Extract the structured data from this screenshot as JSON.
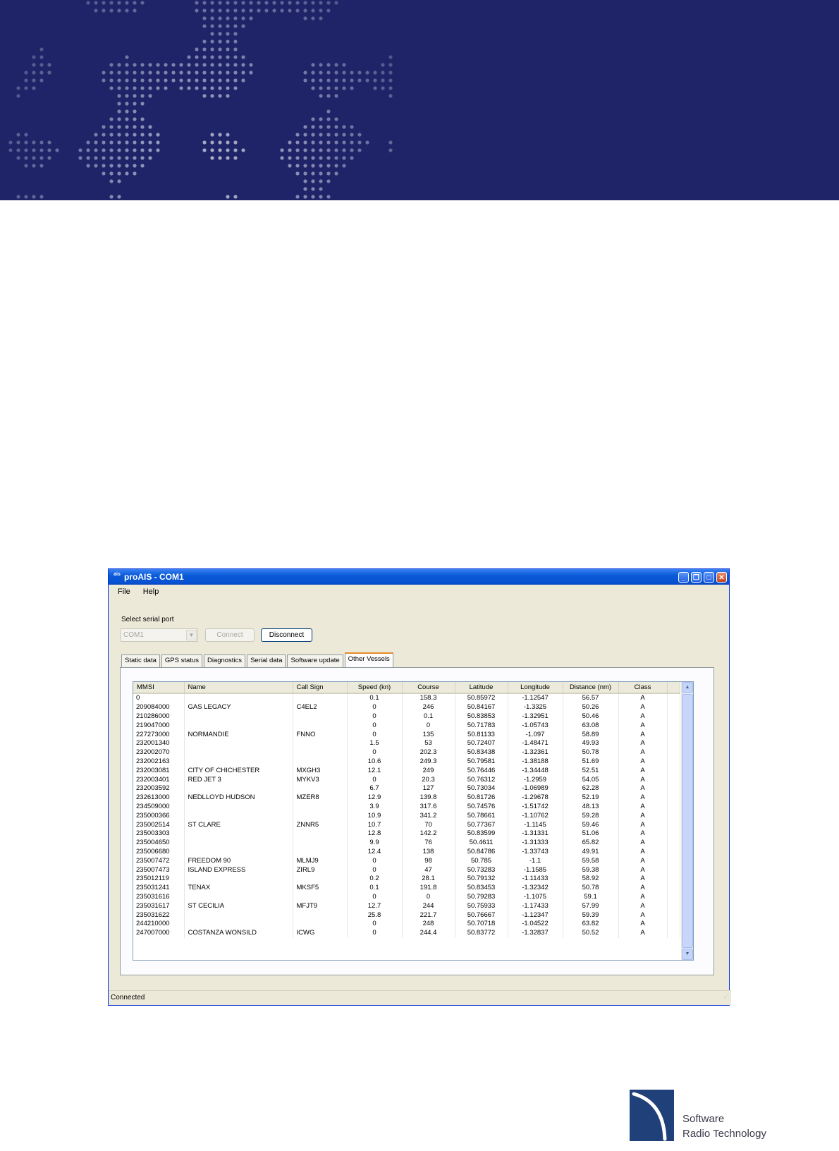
{
  "window": {
    "title": "proAIS - COM1",
    "icon_text": "ais",
    "controls": [
      "minimize-icon",
      "restore-icon",
      "maximize-icon",
      "close-icon"
    ]
  },
  "menu": [
    "File",
    "Help"
  ],
  "serial": {
    "label": "Select serial port",
    "port_value": "COM1",
    "connect_label": "Connect",
    "disconnect_label": "Disconnect"
  },
  "tabs": [
    "Static data",
    "GPS status",
    "Diagnostics",
    "Serial data",
    "Software update",
    "Other Vessels"
  ],
  "active_tab": "Other Vessels",
  "table": {
    "columns": [
      "MMSI",
      "Name",
      "Call Sign",
      "Speed (kn)",
      "Course",
      "Latitude",
      "Longitude",
      "Distance (nm)",
      "Class"
    ],
    "rows": [
      [
        "0",
        "",
        "",
        "0.1",
        "158.3",
        "50.85972",
        "-1.12547",
        "56.57",
        "A"
      ],
      [
        "209084000",
        "GAS LEGACY",
        "C4EL2",
        "0",
        "246",
        "50.84167",
        "-1.3325",
        "50.26",
        "A"
      ],
      [
        "210286000",
        "",
        "",
        "0",
        "0.1",
        "50.83853",
        "-1.32951",
        "50.46",
        "A"
      ],
      [
        "219047000",
        "",
        "",
        "0",
        "0",
        "50.71783",
        "-1.05743",
        "63.08",
        "A"
      ],
      [
        "227273000",
        "NORMANDIE",
        "FNNO",
        "0",
        "135",
        "50.81133",
        "-1.097",
        "58.89",
        "A"
      ],
      [
        "232001340",
        "",
        "",
        "1.5",
        "53",
        "50.72407",
        "-1.48471",
        "49.93",
        "A"
      ],
      [
        "232002070",
        "",
        "",
        "0",
        "202.3",
        "50.83438",
        "-1.32361",
        "50.78",
        "A"
      ],
      [
        "232002163",
        "",
        "",
        "10.6",
        "249.3",
        "50.79581",
        "-1.38188",
        "51.69",
        "A"
      ],
      [
        "232003081",
        "CITY OF CHICHESTER",
        "MXGH3",
        "12.1",
        "249",
        "50.76446",
        "-1.34448",
        "52.51",
        "A"
      ],
      [
        "232003401",
        "RED JET 3",
        "MYKV3",
        "0",
        "20.3",
        "50.76312",
        "-1.2959",
        "54.05",
        "A"
      ],
      [
        "232003592",
        "",
        "",
        "6.7",
        "127",
        "50.73034",
        "-1.06989",
        "62.28",
        "A"
      ],
      [
        "232613000",
        "NEDLLOYD HUDSON",
        "MZER8",
        "12.9",
        "139.8",
        "50.81726",
        "-1.29678",
        "52.19",
        "A"
      ],
      [
        "234509000",
        "",
        "",
        "3.9",
        "317.6",
        "50.74576",
        "-1.51742",
        "48.13",
        "A"
      ],
      [
        "235000366",
        "",
        "",
        "10.9",
        "341.2",
        "50.78661",
        "-1.10762",
        "59.28",
        "A"
      ],
      [
        "235002514",
        "ST CLARE",
        "ZNNR5",
        "10.7",
        "70",
        "50.77367",
        "-1.1145",
        "59.46",
        "A"
      ],
      [
        "235003303",
        "",
        "",
        "12.8",
        "142.2",
        "50.83599",
        "-1.31331",
        "51.06",
        "A"
      ],
      [
        "235004650",
        "",
        "",
        "9.9",
        "76",
        "50.4611",
        "-1.31333",
        "65.82",
        "A"
      ],
      [
        "235006680",
        "",
        "",
        "12.4",
        "138",
        "50.84786",
        "-1.33743",
        "49.91",
        "A"
      ],
      [
        "235007472",
        "FREEDOM 90",
        "MLMJ9",
        "0",
        "98",
        "50.785",
        "-1.1",
        "59.58",
        "A"
      ],
      [
        "235007473",
        "ISLAND EXPRESS",
        "ZIRL9",
        "0",
        "47",
        "50.73283",
        "-1.1585",
        "59.38",
        "A"
      ],
      [
        "235012119",
        "",
        "",
        "0.2",
        "28.1",
        "50.79132",
        "-1.11433",
        "58.92",
        "A"
      ],
      [
        "235031241",
        "TENAX",
        "MKSF5",
        "0.1",
        "191.8",
        "50.83453",
        "-1.32342",
        "50.78",
        "A"
      ],
      [
        "235031616",
        "",
        "",
        "0",
        "0",
        "50.79283",
        "-1.1075",
        "59.1",
        "A"
      ],
      [
        "235031617",
        "ST CECILIA",
        "MFJT9",
        "12.7",
        "244",
        "50.75933",
        "-1.17433",
        "57.99",
        "A"
      ],
      [
        "235031622",
        "",
        "",
        "25.8",
        "221.7",
        "50.76667",
        "-1.12347",
        "59.39",
        "A"
      ],
      [
        "244210000",
        "",
        "",
        "0",
        "248",
        "50.70718",
        "-1.04522",
        "63.82",
        "A"
      ],
      [
        "247007000",
        "COSTANZA WONSILD",
        "ICWG",
        "0",
        "244.4",
        "50.83772",
        "-1.32837",
        "50.52",
        "A"
      ]
    ]
  },
  "status": "Connected",
  "logo": {
    "line1": "Software",
    "line2": "Radio Technology"
  },
  "colors": {
    "banner": "#1f2368",
    "titlebar": "#0a5ad8",
    "window_bg": "#ece9d8",
    "active_tab_accent": "#e68b2c"
  }
}
